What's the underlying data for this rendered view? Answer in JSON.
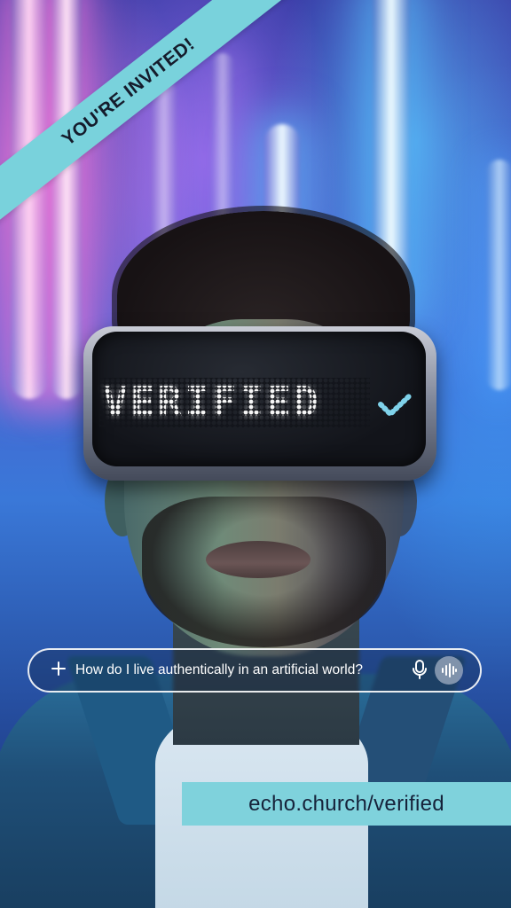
{
  "banner": {
    "invite_label": "YOU'RE INVITED!"
  },
  "headset": {
    "display_text": "VERIFIED",
    "check_icon": "check-icon"
  },
  "search": {
    "placeholder": "How do I live authentically in an artificial world?",
    "add_icon": "plus-icon",
    "mic_icon": "microphone-icon",
    "voice_icon": "voice-wave-icon"
  },
  "footer": {
    "url": "echo.church/verified"
  },
  "colors": {
    "banner_accent": "#79d2dc",
    "url_banner": "#7fd2dc",
    "check": "#7fd2ea",
    "text_dark": "#151c2c"
  }
}
